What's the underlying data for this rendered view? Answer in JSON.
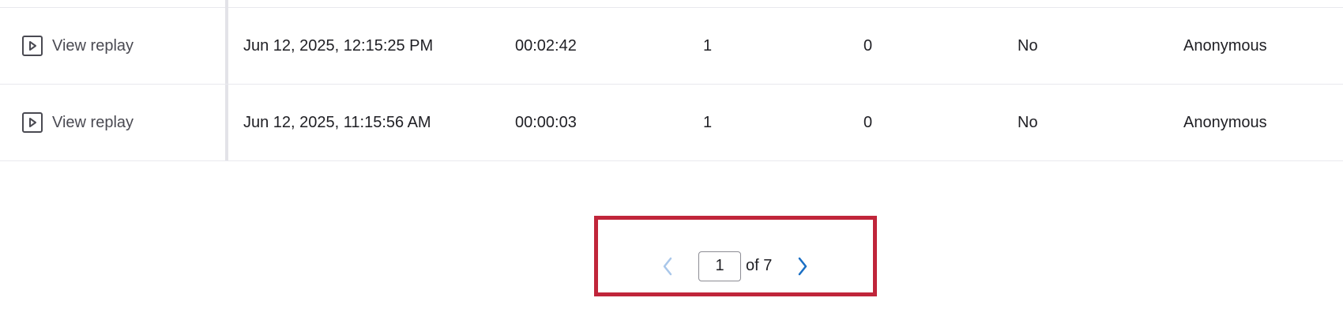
{
  "table": {
    "rows": [
      {
        "action_label": "View replay",
        "date": "Jun 12, 2025, 12:15:25 PM",
        "duration": "00:02:42",
        "count_a": "1",
        "count_b": "0",
        "flag": "No",
        "user": "Anonymous"
      },
      {
        "action_label": "View replay",
        "date": "Jun 12, 2025, 11:15:56 AM",
        "duration": "00:00:03",
        "count_a": "1",
        "count_b": "0",
        "flag": "No",
        "user": "Anonymous"
      }
    ]
  },
  "pagination": {
    "current_page": "1",
    "total_label": "of 7",
    "prev_icon": "chevron-left-icon",
    "next_icon": "chevron-right-icon"
  },
  "colors": {
    "highlight_border": "#c0253a",
    "next_arrow": "#1a6fc4",
    "prev_arrow_disabled": "#a9c7ea"
  }
}
